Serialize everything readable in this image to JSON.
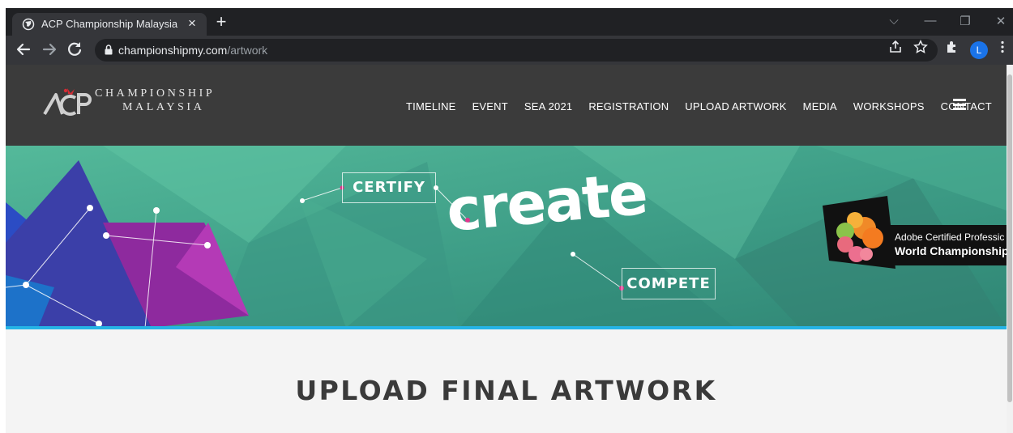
{
  "browser": {
    "tab": {
      "title": "ACP Championship Malaysia",
      "close": "×"
    },
    "new_tab": "+",
    "controls": {
      "dropdown": "⌵",
      "minimize": "—",
      "restore": "❐",
      "close": "✕"
    },
    "url": {
      "host": "championshipmy.com",
      "path": "/artwork"
    },
    "avatar_initial": "L",
    "colors": {
      "frame": "#202124",
      "toolbar": "#35363a",
      "avatar": "#1a73e8"
    }
  },
  "site": {
    "logo": {
      "mark": "ACP",
      "line1": "CHAMPIONSHIP",
      "line2": "MALAYSIA"
    },
    "nav": [
      "TIMELINE",
      "EVENT",
      "SEA 2021",
      "REGISTRATION",
      "UPLOAD ARTWORK",
      "MEDIA",
      "WORKSHOPS",
      "CONTACT"
    ],
    "hero": {
      "certify": "CERTIFY",
      "create": "create",
      "compete": "COMPETE",
      "badge_line1": "Adobe Certified Professic",
      "badge_line2": "World Championship"
    },
    "page_title": "UPLOAD FINAL ARTWORK",
    "colors": {
      "header": "#3b3b3b",
      "accent_bar": "#25b4e6",
      "hero_teal": "#4aa98c"
    }
  }
}
